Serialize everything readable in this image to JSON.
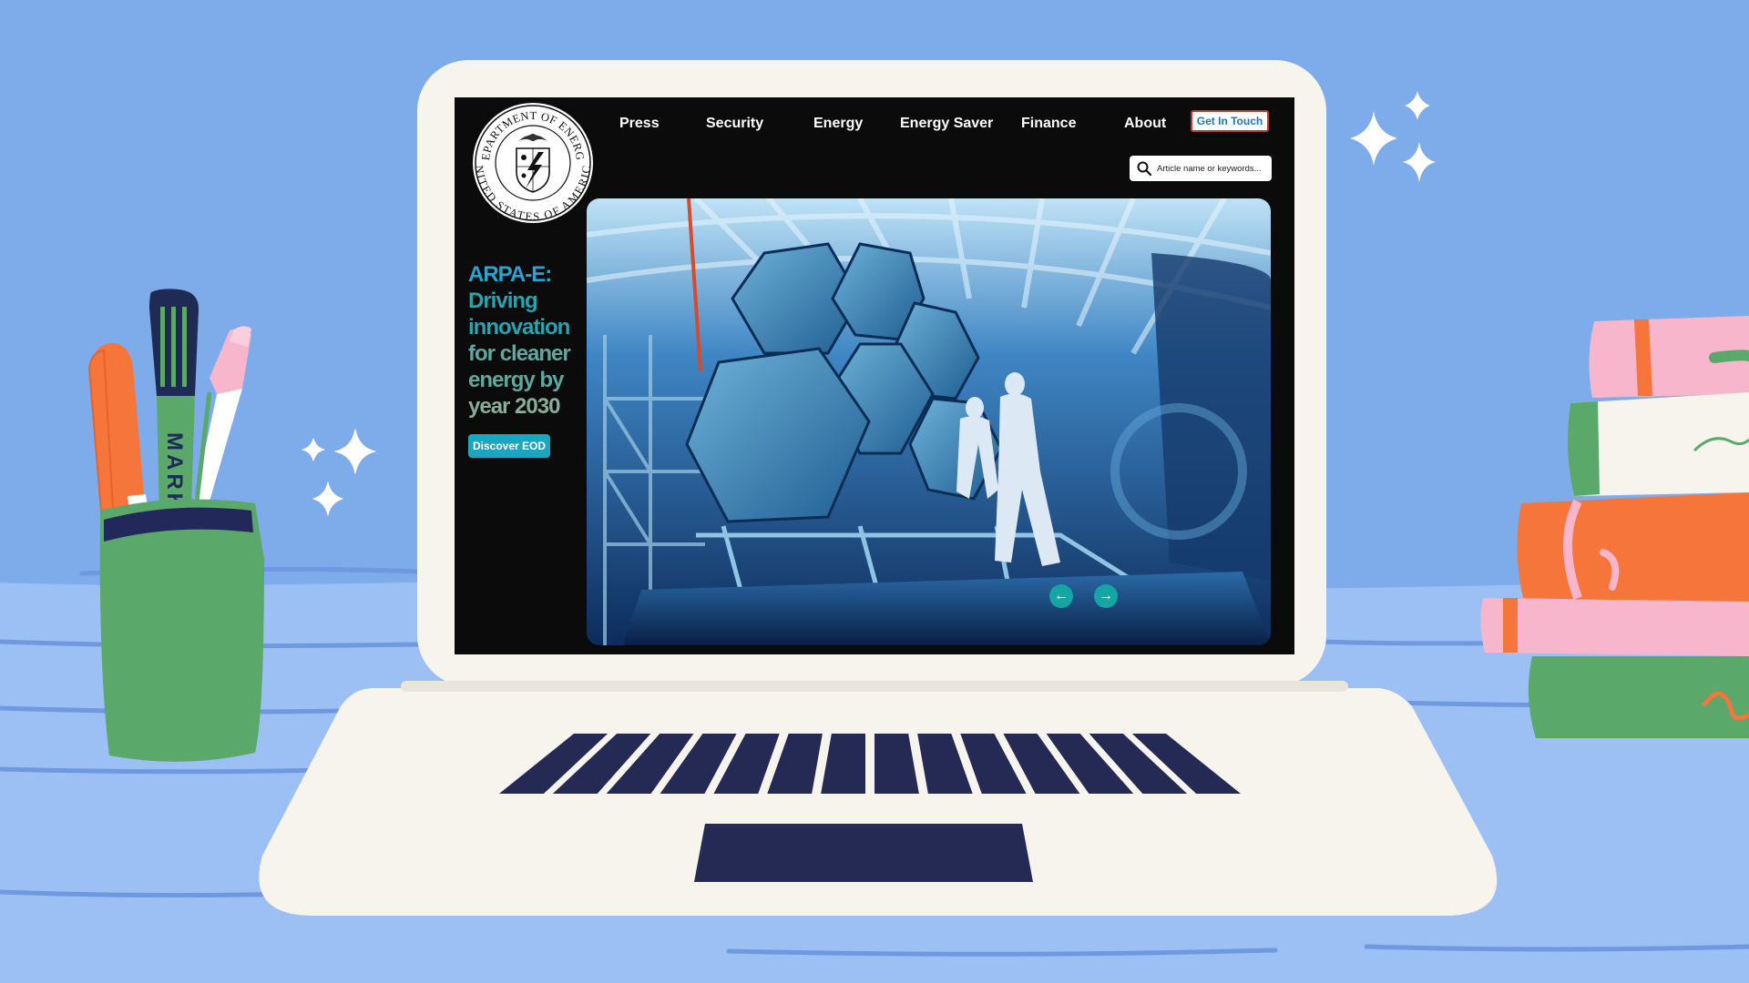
{
  "colors": {
    "background": "#7eabea",
    "laptop": "#f7f4ee",
    "keys": "#242a54",
    "screen": "#0b0b0b",
    "accent_teal": "#1aa6c0",
    "cta_border": "#c7352e",
    "cta_text": "#1d79a3"
  },
  "website": {
    "logo": {
      "top_text": "DEPARTMENT OF ENERGY",
      "bottom_text": "UNITED STATES OF AMERICA"
    },
    "nav": {
      "items": [
        {
          "label": "Press"
        },
        {
          "label": "Security"
        },
        {
          "label": "Energy"
        },
        {
          "label": "Energy Saver"
        },
        {
          "label": "Finance"
        },
        {
          "label": "About"
        }
      ],
      "cta_label": "Get In Touch"
    },
    "search": {
      "placeholder": "Article name or keywords...",
      "icon": "search-icon"
    },
    "hero": {
      "headline_lines": [
        "ARPA-E:",
        "Driving",
        "innovation",
        "for cleaner",
        "energy by",
        "year 2030"
      ],
      "button_label": "Discover EOD",
      "prev_icon": "arrow-left-icon",
      "next_icon": "arrow-right-icon"
    }
  },
  "decor": {
    "marker_label": "MARK"
  }
}
